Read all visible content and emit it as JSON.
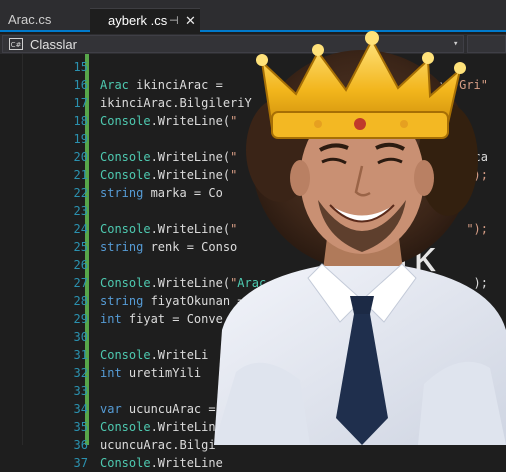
{
  "tabs": [
    {
      "label": "Arac.cs",
      "active": false
    },
    {
      "label": "ayberk .cs",
      "active": true,
      "pin": "⊣",
      "close": "✕"
    }
  ],
  "navigation": {
    "icon": "C#",
    "label": "Classlar",
    "chevron": "▾"
  },
  "lines": [
    {
      "num": "15",
      "code": ""
    },
    {
      "num": "16",
      "code": "Arac ikinciArac = ",
      "tail": "ok: \"Gri\""
    },
    {
      "num": "17",
      "code": "ikinciArac.BilgileriY"
    },
    {
      "num": "18",
      "code": "Console.WriteLine(\""
    },
    {
      "num": "19",
      "code": ""
    },
    {
      "num": "20",
      "code": "Console.WriteLine(\"",
      "tail": "sturaca"
    },
    {
      "num": "21",
      "code": "Console.WriteLine(\"",
      "tail": "\");"
    },
    {
      "num": "22",
      "code": "string marka = Co"
    },
    {
      "num": "23",
      "code": ""
    },
    {
      "num": "24",
      "code": "Console.WriteLine(\"",
      "tail": "\");"
    },
    {
      "num": "25",
      "code": "string renk = Conso"
    },
    {
      "num": "26",
      "code": ""
    },
    {
      "num": "27",
      "code": "Console.WriteLine(\"Arac",
      "tail": ");"
    },
    {
      "num": "28",
      "code": "string fiyatOkunan = "
    },
    {
      "num": "29",
      "code": "int fiyat = Conve"
    },
    {
      "num": "30",
      "code": ""
    },
    {
      "num": "31",
      "code": "Console.WriteLi"
    },
    {
      "num": "32",
      "code": "int uretimYili "
    },
    {
      "num": "33",
      "code": ""
    },
    {
      "num": "34",
      "code": "var ucuncuArac = "
    },
    {
      "num": "35",
      "code": "Console.WriteLin"
    },
    {
      "num": "36",
      "code": "ucuncuArac.Bilgi"
    },
    {
      "num": "37",
      "code": "Console.WriteLine"
    }
  ],
  "ghost_text": "rk",
  "colors": {
    "editor_bg": "#1e1e1e",
    "line_number": "#2b91af",
    "type": "#4ec9b0",
    "keyword": "#569cd6",
    "string": "#d69d85",
    "accent": "#007acc"
  },
  "photo": {
    "subject": "smiling man with curly afro hair wearing a gold crown, white shirt and dark tie"
  }
}
